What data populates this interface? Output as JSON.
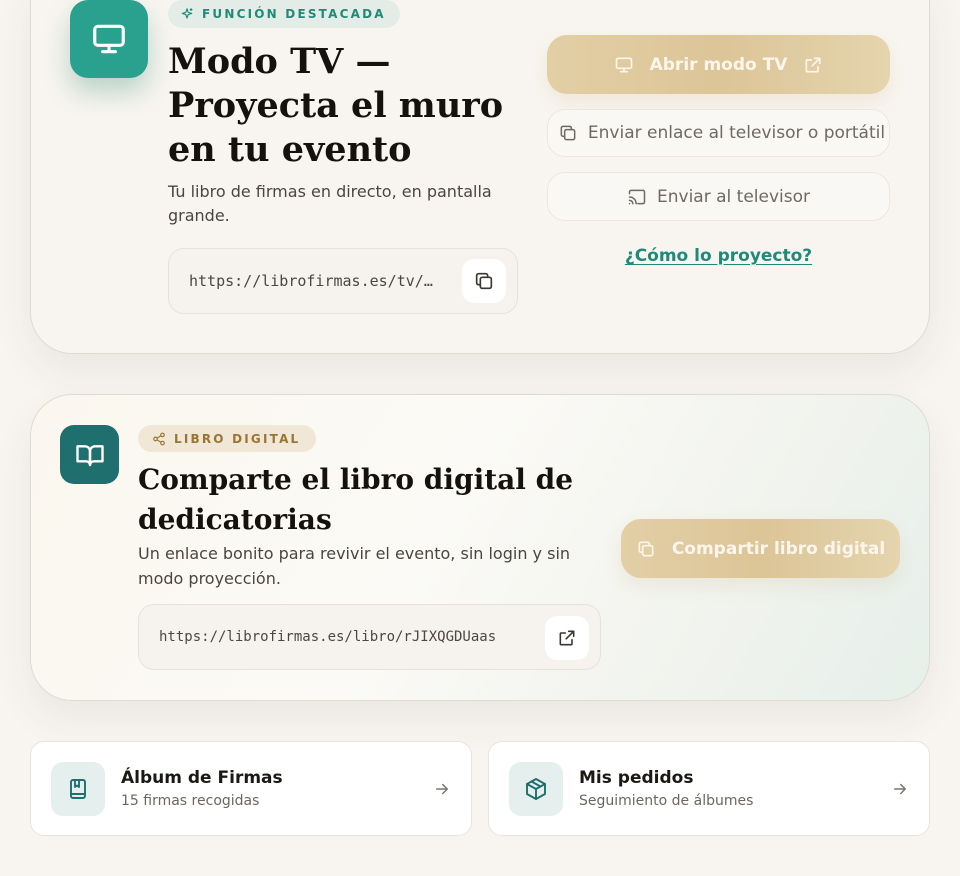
{
  "tv_section": {
    "badge": "FUNCIÓN DESTACADA",
    "title": "Modo TV — Proyecta el muro en tu evento",
    "description": "Tu libro de firmas en directo, en pantalla grande.",
    "url": "https://librofirmas.es/tv/r…",
    "open_button": "Abrir modo TV",
    "send_link_button": "Enviar enlace al televisor o portátil",
    "send_tv_button": "Enviar al televisor",
    "help_link": "¿Cómo lo proyecto?"
  },
  "book_section": {
    "badge": "LIBRO DIGITAL",
    "title": "Comparte el libro digital de dedicatorias",
    "description": "Un enlace bonito para revivir el evento, sin login y sin modo proyección.",
    "url": "https://librofirmas.es/libro/rJIXQGDUaas",
    "share_button": "Compartir libro digital"
  },
  "tiles": [
    {
      "title": "Álbum de Firmas",
      "subtitle": "15 firmas recogidas",
      "icon": "album-icon"
    },
    {
      "title": "Mis pedidos",
      "subtitle": "Seguimiento de álbumes",
      "icon": "package-icon"
    }
  ],
  "colors": {
    "teal": "#2aa08e",
    "dark_teal": "#1f6f6e",
    "gold": "#dcc597",
    "background": "#f8f5f1"
  }
}
